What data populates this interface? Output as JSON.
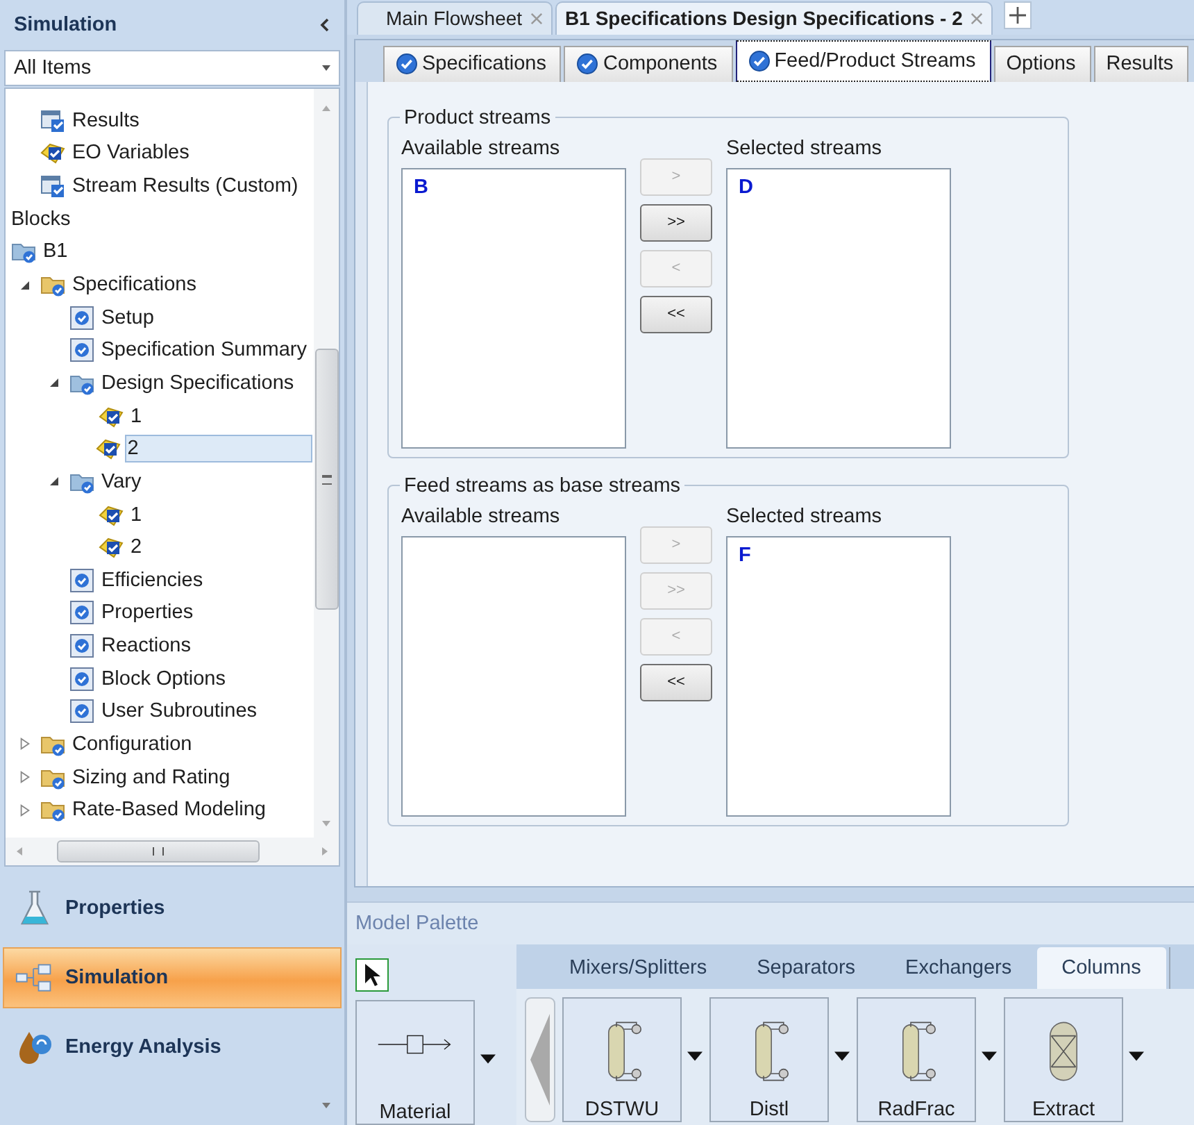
{
  "sidebar": {
    "title": "Simulation",
    "filter": {
      "value": "All Items"
    },
    "tree": {
      "partial_items": [
        {
          "label": "Results",
          "kind": "results",
          "selected": false
        },
        {
          "label": "EO Variables",
          "kind": "eo",
          "selected": false
        },
        {
          "label": "Stream Results (Custom)",
          "kind": "results",
          "selected": false
        }
      ],
      "items": [
        {
          "label": "Blocks",
          "kind": "heading"
        },
        {
          "label": "B1",
          "kind": "blue-folder",
          "selected": false,
          "children": [
            {
              "label": "Specifications",
              "kind": "folder",
              "selected": false,
              "expanded": true,
              "children": [
                {
                  "label": "Setup",
                  "kind": "form",
                  "selected": false
                },
                {
                  "label": "Specification Summary",
                  "kind": "form",
                  "selected": false
                },
                {
                  "label": "Design Specifications",
                  "kind": "blue-folder",
                  "selected": false,
                  "expanded": true,
                  "children": [
                    {
                      "label": "1",
                      "kind": "eo",
                      "selected": false
                    },
                    {
                      "label": "2",
                      "kind": "eo",
                      "selected": true
                    }
                  ]
                },
                {
                  "label": "Vary",
                  "kind": "blue-folder",
                  "selected": false,
                  "expanded": true,
                  "children": [
                    {
                      "label": "1",
                      "kind": "eo",
                      "selected": false
                    },
                    {
                      "label": "2",
                      "kind": "eo",
                      "selected": false
                    }
                  ]
                },
                {
                  "label": "Efficiencies",
                  "kind": "form",
                  "selected": false
                },
                {
                  "label": "Properties",
                  "kind": "form",
                  "selected": false
                },
                {
                  "label": "Reactions",
                  "kind": "form",
                  "selected": false
                },
                {
                  "label": "Block Options",
                  "kind": "form",
                  "selected": false
                },
                {
                  "label": "User Subroutines",
                  "kind": "form",
                  "selected": false
                }
              ]
            },
            {
              "label": "Configuration",
              "kind": "folder",
              "selected": false,
              "expanded": false
            },
            {
              "label": "Sizing and Rating",
              "kind": "folder",
              "selected": false,
              "expanded": false
            },
            {
              "label": "Rate-Based Modeling",
              "kind": "folder",
              "selected": false,
              "expanded": false
            }
          ]
        }
      ]
    },
    "nav": [
      {
        "label": "Properties",
        "kind": "flask",
        "selected": false
      },
      {
        "label": "Simulation",
        "kind": "diagram",
        "selected": true
      },
      {
        "label": "Energy Analysis",
        "kind": "drop",
        "selected": false
      }
    ]
  },
  "doc_tabs": [
    {
      "label": "Main Flowsheet",
      "selected": false
    },
    {
      "label": "B1 Specifications Design Specifications - 2",
      "selected": true
    }
  ],
  "form_tabs": [
    {
      "label": "Specifications",
      "complete": true,
      "selected": false
    },
    {
      "label": "Components",
      "complete": true,
      "selected": false
    },
    {
      "label": "Feed/Product Streams",
      "complete": true,
      "selected": true
    },
    {
      "label": "Options",
      "complete": false,
      "selected": false
    },
    {
      "label": "Results",
      "complete": false,
      "selected": false
    }
  ],
  "groups": [
    {
      "title": "Product streams",
      "available_label": "Available streams",
      "selected_label": "Selected streams",
      "available": [
        "B"
      ],
      "chosen": [
        "D"
      ],
      "buttons": [
        {
          "label": ">",
          "disabled": true
        },
        {
          "label": ">>",
          "disabled": false
        },
        {
          "label": "<",
          "disabled": true
        },
        {
          "label": "<<",
          "disabled": false
        }
      ]
    },
    {
      "title": "Feed streams as base streams",
      "available_label": "Available streams",
      "selected_label": "Selected streams",
      "chosen": [
        "F"
      ],
      "buttons": [
        {
          "label": ">",
          "disabled": true
        },
        {
          "label": ">>",
          "disabled": true
        },
        {
          "label": "<",
          "disabled": true
        },
        {
          "label": "<<",
          "disabled": false
        }
      ]
    }
  ],
  "palette": {
    "title": "Model Palette",
    "stream": {
      "label": "Material"
    },
    "tabs": [
      {
        "label": "Mixers/Splitters",
        "selected": false
      },
      {
        "label": "Separators",
        "selected": false
      },
      {
        "label": "Exchangers",
        "selected": false
      },
      {
        "label": "Columns",
        "selected": true
      }
    ],
    "models": [
      {
        "label": "DSTWU",
        "kind": "column"
      },
      {
        "label": "Distl",
        "kind": "column"
      },
      {
        "label": "RadFrac",
        "kind": "column"
      },
      {
        "label": "Extract",
        "kind": "extractor"
      }
    ]
  }
}
